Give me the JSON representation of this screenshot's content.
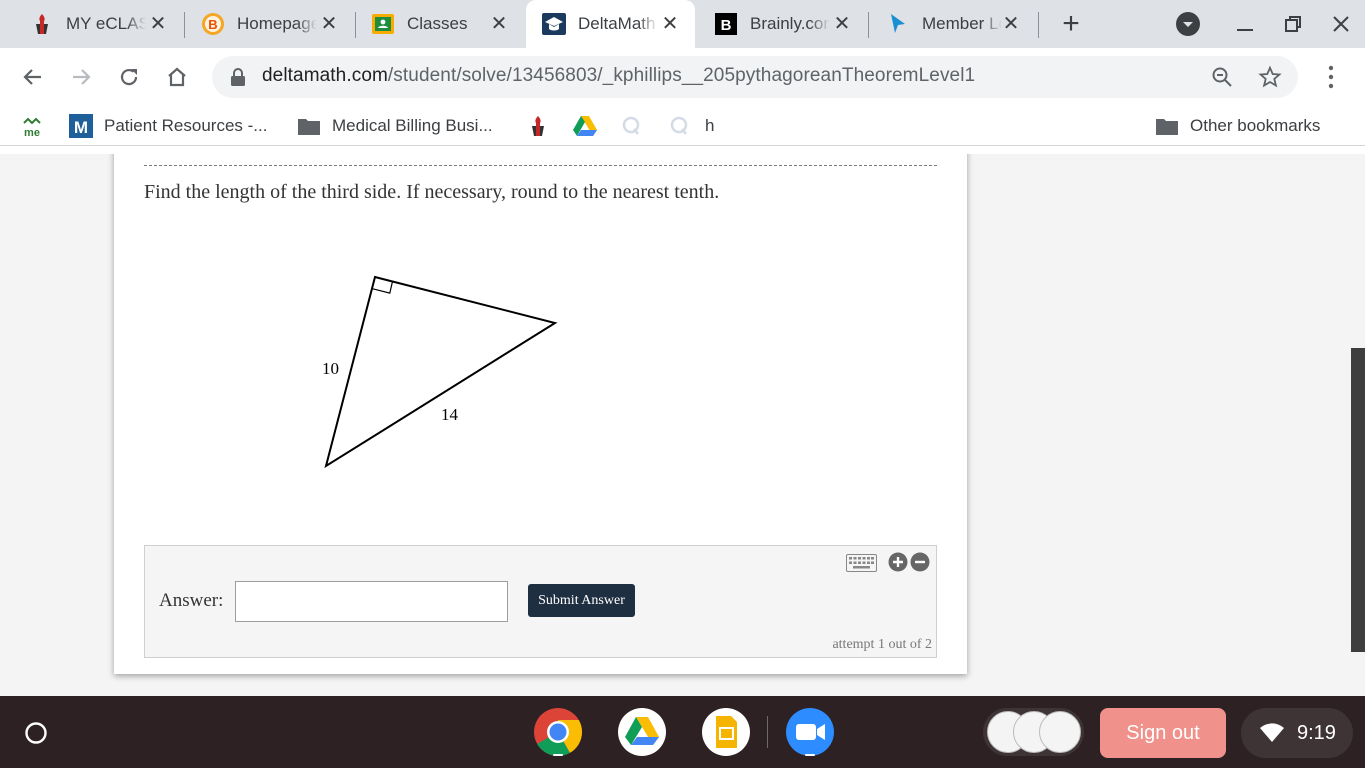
{
  "browser": {
    "tabs": [
      {
        "title": "MY eCLASS",
        "icon": "eclass-icon"
      },
      {
        "title": "Homepage",
        "icon": "homepage-b-icon"
      },
      {
        "title": "Classes",
        "icon": "google-classroom-icon"
      },
      {
        "title": "DeltaMath",
        "icon": "deltamath-icon",
        "active": true
      },
      {
        "title": "Brainly.com",
        "icon": "brainly-icon"
      },
      {
        "title": "Member Login",
        "icon": "cursor-arrow-icon"
      }
    ],
    "new_tab_label": "+",
    "url": {
      "host": "deltamath.com",
      "path": "/student/solve/13456803/_kphillips__205pythagoreanTheoremLevel1"
    },
    "bookmarks": [
      {
        "label": "",
        "icon": "me-icon"
      },
      {
        "label": "Patient Resources -...",
        "icon": "m-logo-icon"
      },
      {
        "label": "Medical Billing Busi...",
        "icon": "folder-icon"
      },
      {
        "label": "",
        "icon": "eclass-icon"
      },
      {
        "label": "",
        "icon": "google-drive-icon"
      },
      {
        "label": "",
        "icon": "q-icon"
      },
      {
        "label": "",
        "icon": "q-icon"
      },
      {
        "label": "h",
        "icon": ""
      }
    ],
    "other_bookmarks": "Other bookmarks"
  },
  "problem": {
    "instruction": "Find the length of the third side. If necessary, round to the nearest tenth.",
    "figure": {
      "type": "right-triangle",
      "side_labels": [
        "10",
        "14"
      ]
    }
  },
  "answer": {
    "label": "Answer:",
    "input_value": "",
    "submit_label": "Submit Answer",
    "attempt_text": "attempt 1 out of 2"
  },
  "shelf": {
    "apps": [
      "chrome-icon",
      "google-drive-icon",
      "google-slides-icon",
      "zoom-icon"
    ],
    "signout_label": "Sign out",
    "time": "9:19"
  },
  "colors": {
    "tabstrip_bg": "#dee1e6",
    "shelf_bg": "#2d2124",
    "submit_bg": "#1f2f42",
    "signout_bg": "#f0918b"
  }
}
